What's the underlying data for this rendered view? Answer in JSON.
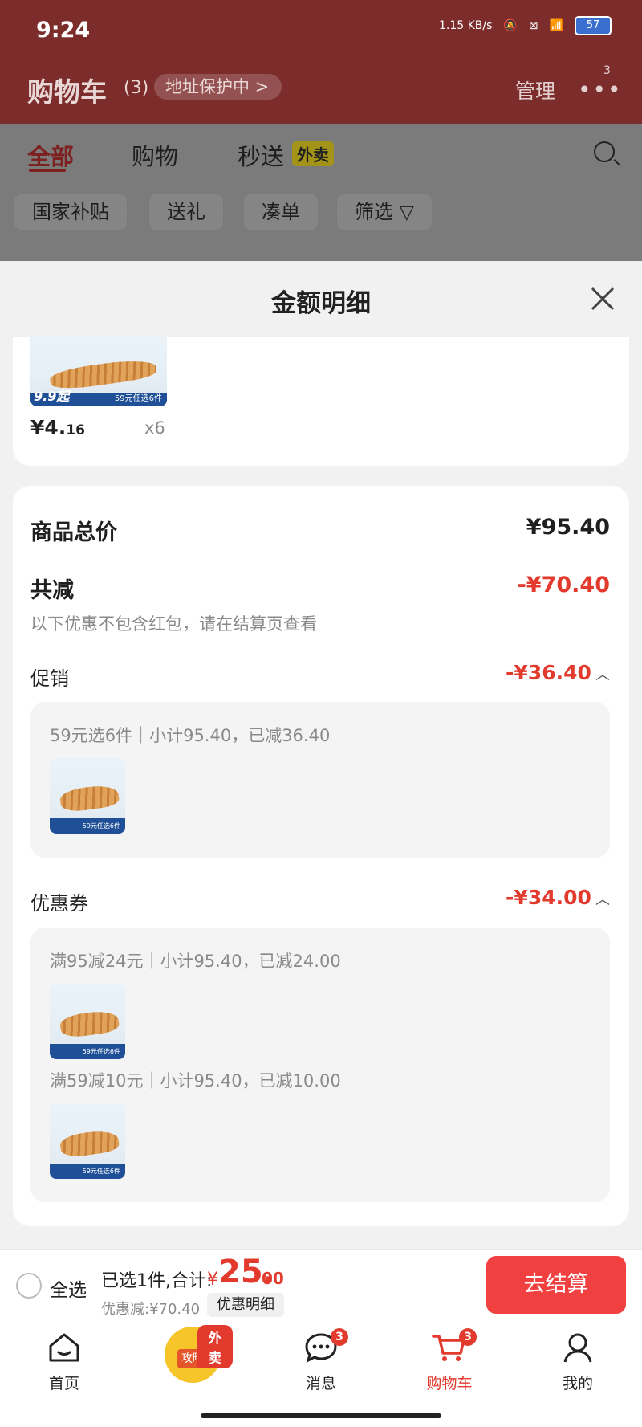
{
  "status_bar": {
    "time": "9:24",
    "net_speed": "1.15 KB/s",
    "battery": "57"
  },
  "header": {
    "title": "购物车",
    "count": "(3)",
    "address_protect": "地址保护中 >",
    "manage": "管理",
    "more_badge": "3"
  },
  "tabs": [
    {
      "label": "全部"
    },
    {
      "label": "购物"
    },
    {
      "label": "秒送"
    }
  ],
  "tab_tag": "外卖",
  "filters": [
    "国家补贴",
    "送礼",
    "凑单",
    "筛选 ▽"
  ],
  "sheet": {
    "title": "金额明细",
    "item": {
      "price_int": "¥4.",
      "price_dec": "16",
      "qty": "x6",
      "badge_price": "9.9起",
      "badge_promo": "59元任选6件"
    },
    "total_label": "商品总价",
    "total_value": "¥95.40",
    "reduce_label": "共减",
    "reduce_value": "-¥70.40",
    "reduce_note": "以下优惠不包含红包，请在结算页查看",
    "promo": {
      "label": "促销",
      "value": "-¥36.40",
      "rules": [
        "59元选6件｜小计95.40，已减36.40"
      ]
    },
    "coupon": {
      "label": "优惠券",
      "value": "-¥34.00",
      "rules": [
        "满95减24元｜小计95.40，已减24.00",
        "满59减10元｜小计95.40，已减10.00"
      ]
    }
  },
  "bottom": {
    "select_all": "全选",
    "selected_text": "已选1件,合计:",
    "currency": "¥",
    "total_int": "25.",
    "total_dec": "00",
    "discount": "优惠减:¥70.40",
    "detail_button": "优惠明细",
    "checkout": "去结算"
  },
  "nav": {
    "home": "首页",
    "strategy": "攻略",
    "waimai_tag": "外卖",
    "messages": "消息",
    "messages_badge": "3",
    "cart": "购物车",
    "cart_badge": "3",
    "mine": "我的"
  },
  "colors": {
    "accent_red": "#e23b2e",
    "checkout_red": "#f04040",
    "header_dim": "#7c2d2b"
  }
}
